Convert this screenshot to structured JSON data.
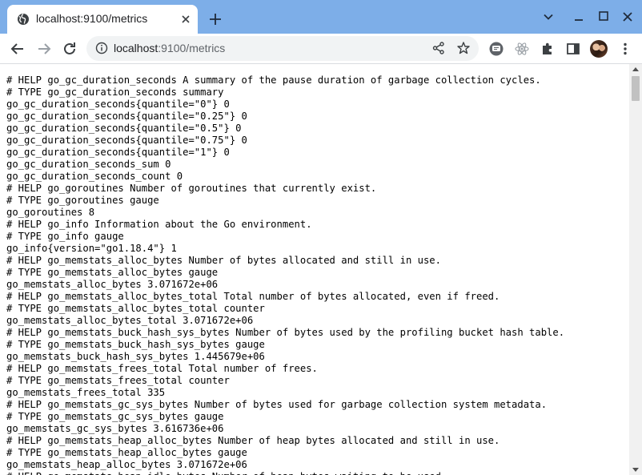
{
  "browser": {
    "tab": {
      "title": "localhost:9100/metrics"
    },
    "address_bar": {
      "host": "localhost",
      "rest": ":9100/metrics"
    }
  },
  "metrics_text": [
    "# HELP go_gc_duration_seconds A summary of the pause duration of garbage collection cycles.",
    "# TYPE go_gc_duration_seconds summary",
    "go_gc_duration_seconds{quantile=\"0\"} 0",
    "go_gc_duration_seconds{quantile=\"0.25\"} 0",
    "go_gc_duration_seconds{quantile=\"0.5\"} 0",
    "go_gc_duration_seconds{quantile=\"0.75\"} 0",
    "go_gc_duration_seconds{quantile=\"1\"} 0",
    "go_gc_duration_seconds_sum 0",
    "go_gc_duration_seconds_count 0",
    "# HELP go_goroutines Number of goroutines that currently exist.",
    "# TYPE go_goroutines gauge",
    "go_goroutines 8",
    "# HELP go_info Information about the Go environment.",
    "# TYPE go_info gauge",
    "go_info{version=\"go1.18.4\"} 1",
    "# HELP go_memstats_alloc_bytes Number of bytes allocated and still in use.",
    "# TYPE go_memstats_alloc_bytes gauge",
    "go_memstats_alloc_bytes 3.071672e+06",
    "# HELP go_memstats_alloc_bytes_total Total number of bytes allocated, even if freed.",
    "# TYPE go_memstats_alloc_bytes_total counter",
    "go_memstats_alloc_bytes_total 3.071672e+06",
    "# HELP go_memstats_buck_hash_sys_bytes Number of bytes used by the profiling bucket hash table.",
    "# TYPE go_memstats_buck_hash_sys_bytes gauge",
    "go_memstats_buck_hash_sys_bytes 1.445679e+06",
    "# HELP go_memstats_frees_total Total number of frees.",
    "# TYPE go_memstats_frees_total counter",
    "go_memstats_frees_total 335",
    "# HELP go_memstats_gc_sys_bytes Number of bytes used for garbage collection system metadata.",
    "# TYPE go_memstats_gc_sys_bytes gauge",
    "go_memstats_gc_sys_bytes 3.616736e+06",
    "# HELP go_memstats_heap_alloc_bytes Number of heap bytes allocated and still in use.",
    "# TYPE go_memstats_heap_alloc_bytes gauge",
    "go_memstats_heap_alloc_bytes 3.071672e+06",
    "# HELP go_memstats_heap_idle_bytes Number of heap bytes waiting to be used."
  ],
  "icons": {
    "tab_favicon": "globe-icon",
    "tab_close": "close-icon",
    "new_tab": "plus-icon",
    "tab_search": "chevron-down-icon",
    "minimize": "minimize-icon",
    "maximize": "maximize-icon",
    "close_window": "close-icon",
    "back": "arrow-left-icon",
    "forward": "arrow-right-icon",
    "reload": "reload-icon",
    "site_info": "info-icon",
    "share": "share-icon",
    "bookmark": "star-icon",
    "extensions": [
      "chat-extension-icon",
      "react-devtools-icon",
      "puzzle-icon"
    ],
    "side_panel": "side-panel-icon",
    "menu": "kebab-menu-icon"
  },
  "colors": {
    "tab_strip": "#7daee8",
    "omnibox": "#f1f3f4",
    "text": "#000000"
  }
}
